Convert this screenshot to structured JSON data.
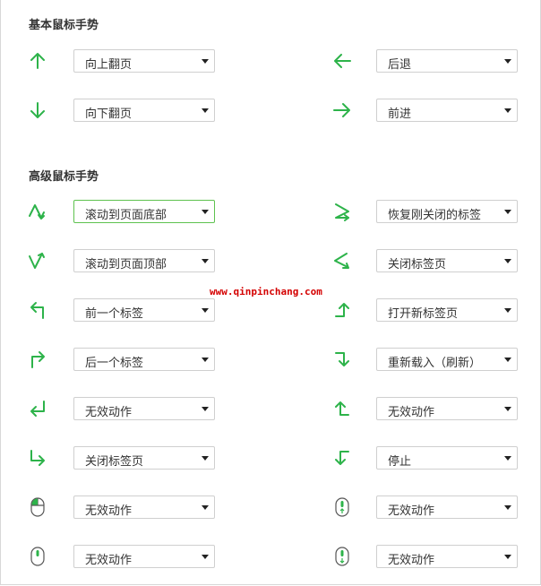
{
  "sections": {
    "basic": "基本鼠标手势",
    "advanced": "高级鼠标手势"
  },
  "options": {
    "r1_left": "向上翻页",
    "r1_right": "后退",
    "r2_left": "向下翻页",
    "r2_right": "前进",
    "r3_left": "滚动到页面底部",
    "r3_right": "恢复刚关闭的标签",
    "r4_left": "滚动到页面顶部",
    "r4_right": "关闭标签页",
    "r5_left": "前一个标签",
    "r5_right": "打开新标签页",
    "r6_left": "后一个标签",
    "r6_right": "重新载入（刷新）",
    "r7_left": "无效动作",
    "r7_right": "无效动作",
    "r8_left": "关闭标签页",
    "r8_right": "停止",
    "r9_left": "无效动作",
    "r9_right": "无效动作",
    "r10_left": "无效动作",
    "r10_right": "无效动作"
  },
  "watermark": "www.qinpinchang.com",
  "colors": {
    "accent": "#2db34a",
    "active_border": "#5ec24f"
  }
}
